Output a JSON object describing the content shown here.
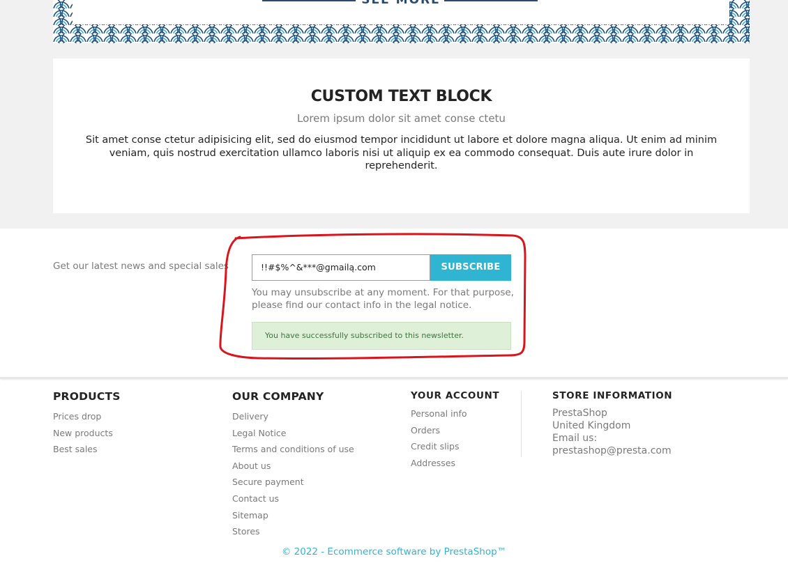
{
  "banner": {
    "button_label": "SEE MORE"
  },
  "custom_text_block": {
    "title": "CUSTOM TEXT BLOCK",
    "subtitle": "Lorem ipsum dolor sit amet conse ctetu",
    "body": "Sit amet conse ctetur adipisicing elit, sed do eiusmod tempor incididunt ut labore et dolore magna aliqua. Ut enim ad minim veniam, quis nostrud exercitation ullamco laboris nisi ut aliquip ex ea commodo consequat. Duis aute irure dolor in reprehenderit."
  },
  "newsletter": {
    "label": "Get our latest news and special sales",
    "email_value": "!!#$%^&***@gmailą.com",
    "subscribe_label": "SUBSCRIBE",
    "note": "You may unsubscribe at any moment. For that purpose, please find our contact info in the legal notice.",
    "success_message": "You have successfully subscribed to this newsletter.",
    "annotation_color": "#d9141b"
  },
  "footer": {
    "products": {
      "title": "PRODUCTS",
      "links": [
        "Prices drop",
        "New products",
        "Best sales"
      ]
    },
    "our_company": {
      "title": "OUR COMPANY",
      "links": [
        "Delivery",
        "Legal Notice",
        "Terms and conditions of use",
        "About us",
        "Secure payment",
        "Contact us",
        "Sitemap",
        "Stores"
      ]
    },
    "your_account": {
      "title": "YOUR ACCOUNT",
      "links": [
        "Personal info",
        "Orders",
        "Credit slips",
        "Addresses"
      ]
    },
    "store_information": {
      "title": "STORE INFORMATION",
      "lines": [
        "PrestaShop",
        "United Kingdom",
        "Email us:",
        "prestashop@presta.com"
      ]
    },
    "copyright": "© 2022 - Ecommerce software by PrestaShop™"
  },
  "colors": {
    "accent": "#2fb5d2",
    "wave_dark": "#1d4e7a",
    "wave_light": "#3ab0dc",
    "success_bg": "#dff0d8",
    "success_text": "#3c763d"
  }
}
